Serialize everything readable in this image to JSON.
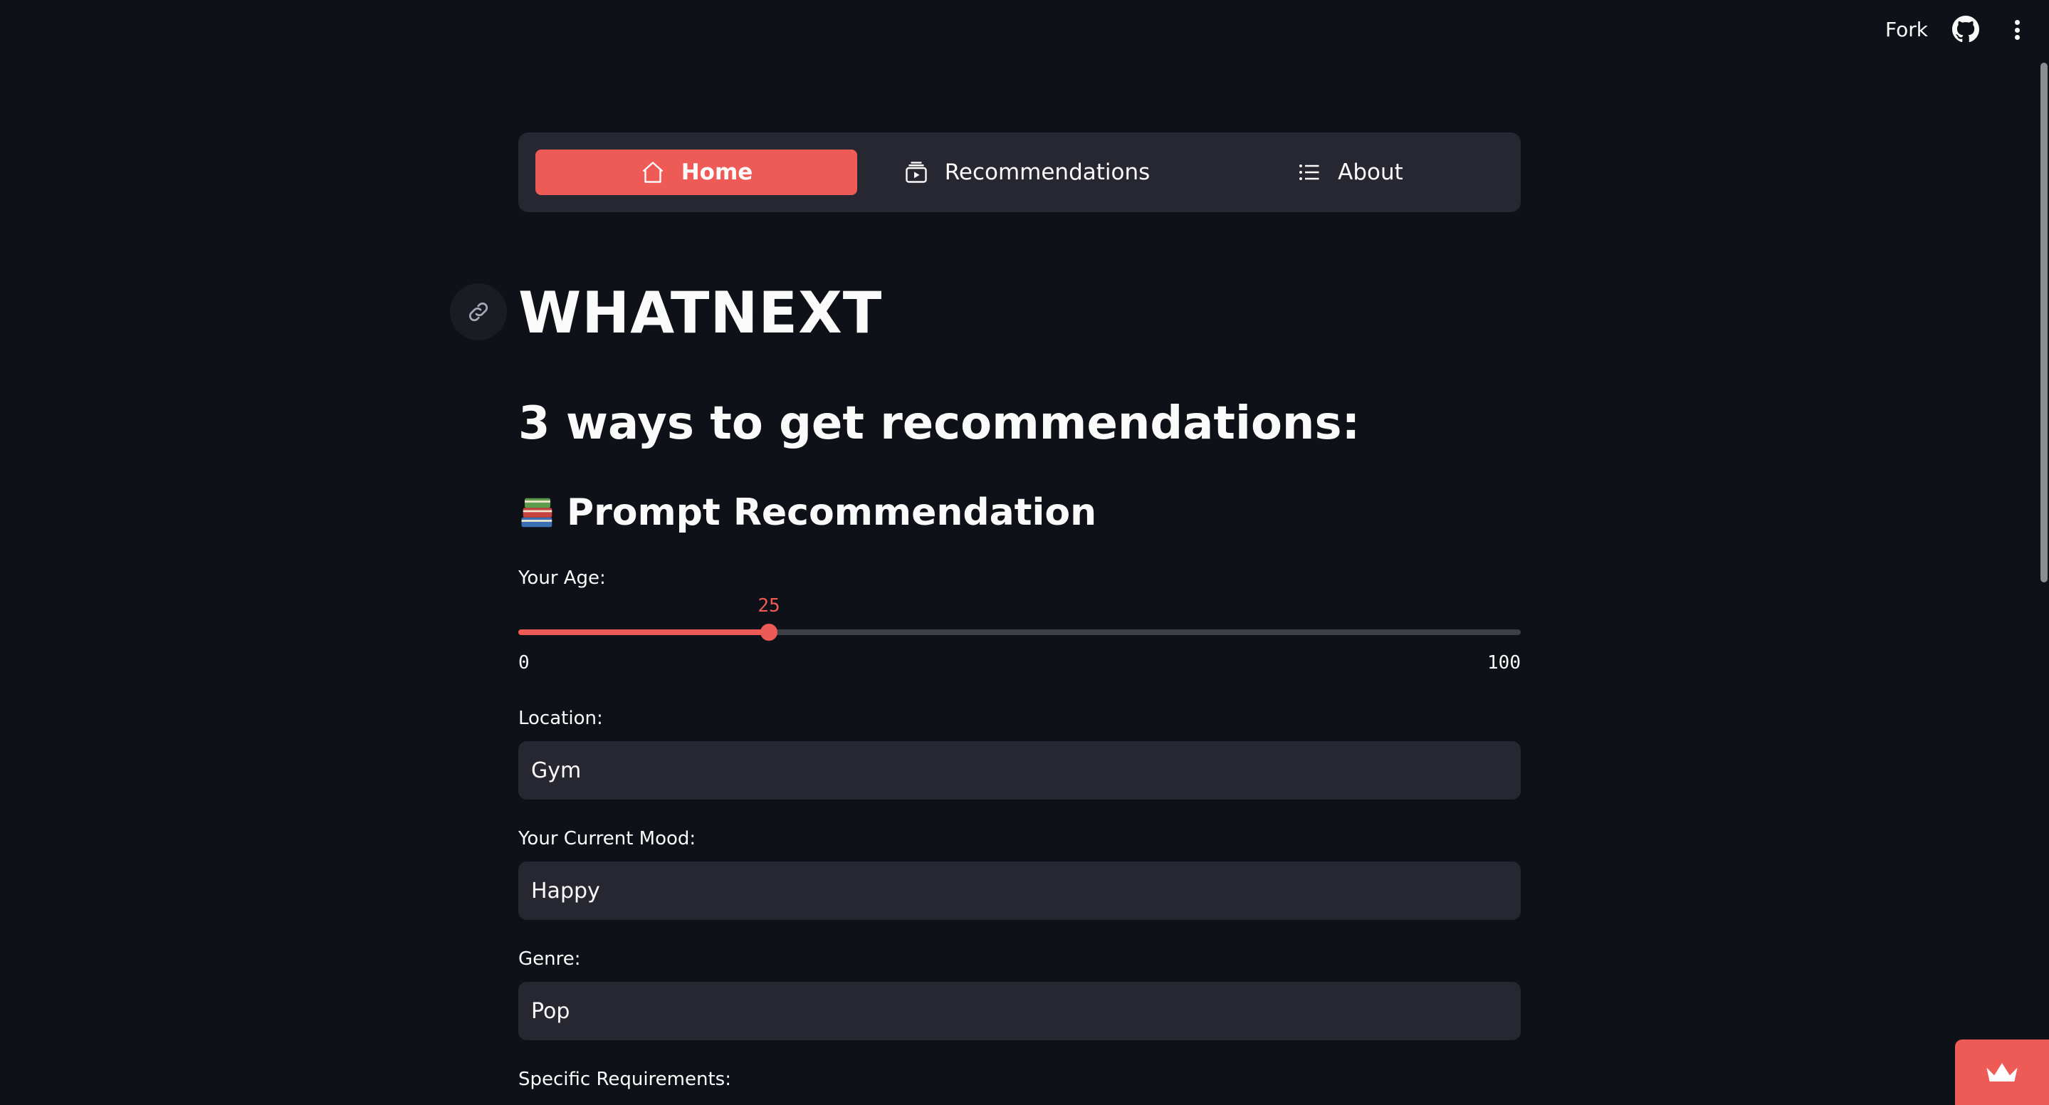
{
  "topbar": {
    "fork_label": "Fork",
    "github_icon": "github-icon",
    "menu_icon": "kebab-menu-icon"
  },
  "nav": {
    "items": [
      {
        "label": "Home",
        "icon": "home-icon",
        "active": true
      },
      {
        "label": "Recommendations",
        "icon": "media-stack-icon",
        "active": false
      },
      {
        "label": "About",
        "icon": "list-icon",
        "active": false
      }
    ]
  },
  "page": {
    "title": "WHATNEXT",
    "subtitle": "3 ways to get recommendations:",
    "section_title": "Prompt Recommendation",
    "section_icon": "books-emoji-icon"
  },
  "form": {
    "age": {
      "label": "Your Age:",
      "value": "25",
      "min": "0",
      "max": "100"
    },
    "location": {
      "label": "Location:",
      "value": "Gym"
    },
    "mood": {
      "label": "Your Current Mood:",
      "value": "Happy"
    },
    "genre": {
      "label": "Genre:",
      "value": "Pop"
    },
    "requirements": {
      "label": "Specific Requirements:"
    }
  },
  "colors": {
    "background": "#0e1117",
    "accent": "#ee5a55",
    "input_bg": "#262730"
  }
}
